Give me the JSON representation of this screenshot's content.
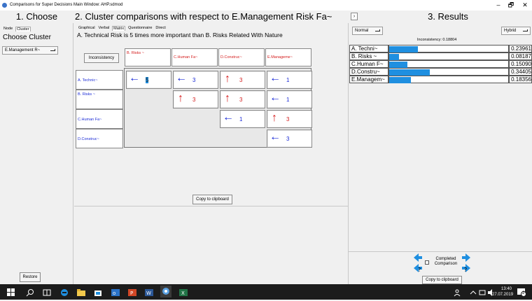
{
  "window": {
    "title": "Comparisons for Super Decisions Main Window: AHP.sdmod",
    "controls": [
      "–",
      "🗗",
      "✕"
    ]
  },
  "sections": {
    "choose": "1. Choose",
    "compare": "2. Cluster comparisons with respect to E.Management Risk Fa~",
    "results": "3. Results"
  },
  "choose": {
    "tabs": [
      "Node",
      "Cluster"
    ],
    "heading": "Choose Cluster",
    "selected": "E.Management R~",
    "restore_label": "Restore"
  },
  "compare": {
    "tabs": [
      "Graphical",
      "Verbal",
      "Matrix",
      "Questionnaire",
      "Direct"
    ],
    "active_tab": "Matrix",
    "statement": "A. Technical Risk is 5 times more important than  B. Risks Related With Nature",
    "inconsistency_btn": "Inconsistency",
    "col_headers": [
      "B. Risks ~",
      "C.Human Fa~",
      "D.Construc~",
      "E.Manageme~"
    ],
    "row_headers": [
      "A. Technic~",
      "B. Risks ~",
      "C.Human Fa~",
      "D.Construc~"
    ],
    "cells": [
      {
        "r": 0,
        "c": 0,
        "dir": "left",
        "value": "5",
        "selected": true
      },
      {
        "r": 0,
        "c": 1,
        "dir": "left",
        "value": "3"
      },
      {
        "r": 0,
        "c": 2,
        "dir": "up",
        "value": "3"
      },
      {
        "r": 0,
        "c": 3,
        "dir": "left",
        "value": "1"
      },
      {
        "r": 1,
        "c": 1,
        "dir": "up",
        "value": "3"
      },
      {
        "r": 1,
        "c": 2,
        "dir": "up",
        "value": "3"
      },
      {
        "r": 1,
        "c": 3,
        "dir": "left",
        "value": "1"
      },
      {
        "r": 2,
        "c": 2,
        "dir": "left",
        "value": "1"
      },
      {
        "r": 2,
        "c": 3,
        "dir": "up",
        "value": "3"
      },
      {
        "r": 3,
        "c": 3,
        "dir": "left",
        "value": "3"
      }
    ],
    "copy_label": "Copy to clipboard"
  },
  "results": {
    "mode_left": "Normal",
    "mode_right": "Hybrid",
    "inconsistency": "Inconsistency: 0.18804",
    "rows": [
      {
        "label": "A. Techni~",
        "value": "0.23961",
        "fraction": 0.23961
      },
      {
        "label": "B. Risks ~",
        "value": "0.08187",
        "fraction": 0.08187
      },
      {
        "label": "C.Human F~",
        "value": "0.15090",
        "fraction": 0.1509
      },
      {
        "label": "D.Constru~",
        "value": "0.34405",
        "fraction": 0.34405
      },
      {
        "label": "E.Managem~",
        "value": "0.18356",
        "fraction": 0.18356
      }
    ],
    "completed_label": "Completed Comparison",
    "copy_label": "Copy to clipboard"
  },
  "taskbar": {
    "time": "13:40",
    "date": "27.07.2019",
    "notifications": "2"
  },
  "colors": {
    "arrow_blue": "#1b2bd6",
    "arrow_red": "#d41d1d",
    "bar": "#1f8fe0",
    "taskbar": "#1c1c1c"
  }
}
